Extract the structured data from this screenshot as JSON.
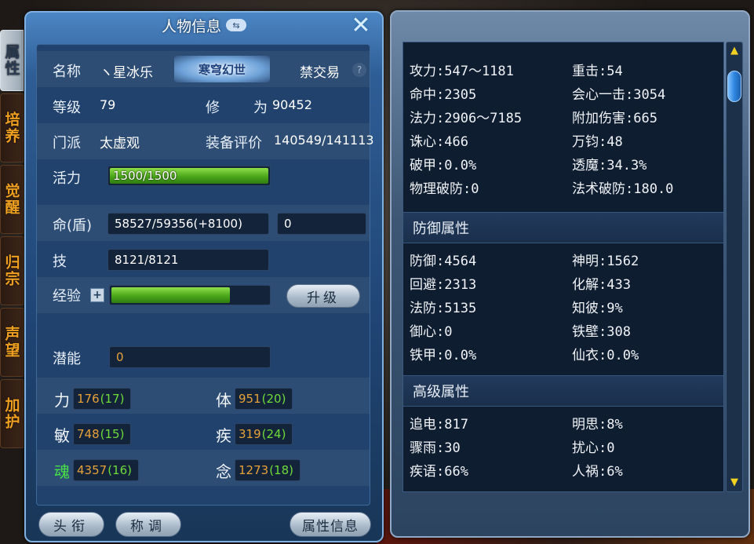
{
  "window": {
    "title": "人物信息",
    "swap_icon": "⇆",
    "close_icon": "✕"
  },
  "side_tabs": [
    "属性",
    "培养",
    "觉醒",
    "归宗",
    "声望",
    "加护"
  ],
  "profile": {
    "name_label": "名称",
    "name_value": "ヽ星冰乐",
    "title_badge": "寒穹幻世",
    "trade_status": "禁交易",
    "help_icon": "?",
    "level_label": "等级",
    "level_value": "79",
    "cultivation_label_1": "修",
    "cultivation_label_2": "为",
    "cultivation_value": "90452",
    "sect_label": "门派",
    "sect_value": "太虚观",
    "equip_label": "装备评价",
    "equip_value": "140549/141113",
    "vitality_label": "活力",
    "vitality_value": "1500/1500",
    "vitality_fill": 1.0
  },
  "resources": {
    "hp_label": "命(盾)",
    "hp_value": "58527/59356(+8100)",
    "hp_extra": "0",
    "skill_label": "技",
    "skill_value": "8121/8121",
    "exp_label": "经验",
    "exp_plus": "+",
    "exp_fill": 0.76,
    "levelup_button": "升级",
    "potential_label": "潜能",
    "potential_value": "0"
  },
  "stats": [
    {
      "name": "力",
      "base": "176",
      "bonus": "(17)"
    },
    {
      "name": "体",
      "base": "951",
      "bonus": "(20)"
    },
    {
      "name": "敏",
      "base": "748",
      "bonus": "(15)"
    },
    {
      "name": "疾",
      "base": "319",
      "bonus": "(24)"
    },
    {
      "name": "魂",
      "base": "4357",
      "bonus": "(16)"
    },
    {
      "name": "念",
      "base": "1273",
      "bonus": "(18)"
    }
  ],
  "bottom_buttons": {
    "avatar": "头衔",
    "title": "称调",
    "attr_info": "属性信息"
  },
  "attributes": {
    "attack_rows": [
      [
        "攻力:547～1181",
        "重击:54"
      ],
      [
        "命中:2305",
        "会心一击:3054"
      ],
      [
        "法力:2906～7185",
        "附加伤害:665"
      ],
      [
        "诛心:466",
        "万钧:48"
      ],
      [
        "破甲:0.0%",
        "透魔:34.3%"
      ],
      [
        "物理破防:0",
        "法术破防:180.0"
      ]
    ],
    "defense_header": "防御属性",
    "defense_rows": [
      [
        "防御:4564",
        "神明:1562"
      ],
      [
        "回避:2313",
        "化解:433"
      ],
      [
        "法防:5135",
        "知彼:9%"
      ],
      [
        "御心:0",
        "铁壁:308"
      ],
      [
        "铁甲:0.0%",
        "仙衣:0.0%"
      ]
    ],
    "advanced_header": "高级属性",
    "advanced_rows": [
      [
        "追电:817",
        "明思:8%"
      ],
      [
        "骤雨:30",
        "扰心:0"
      ],
      [
        "疾语:66%",
        "人祸:6%"
      ]
    ]
  },
  "scroll": {
    "up": "▲",
    "down": "▼"
  }
}
